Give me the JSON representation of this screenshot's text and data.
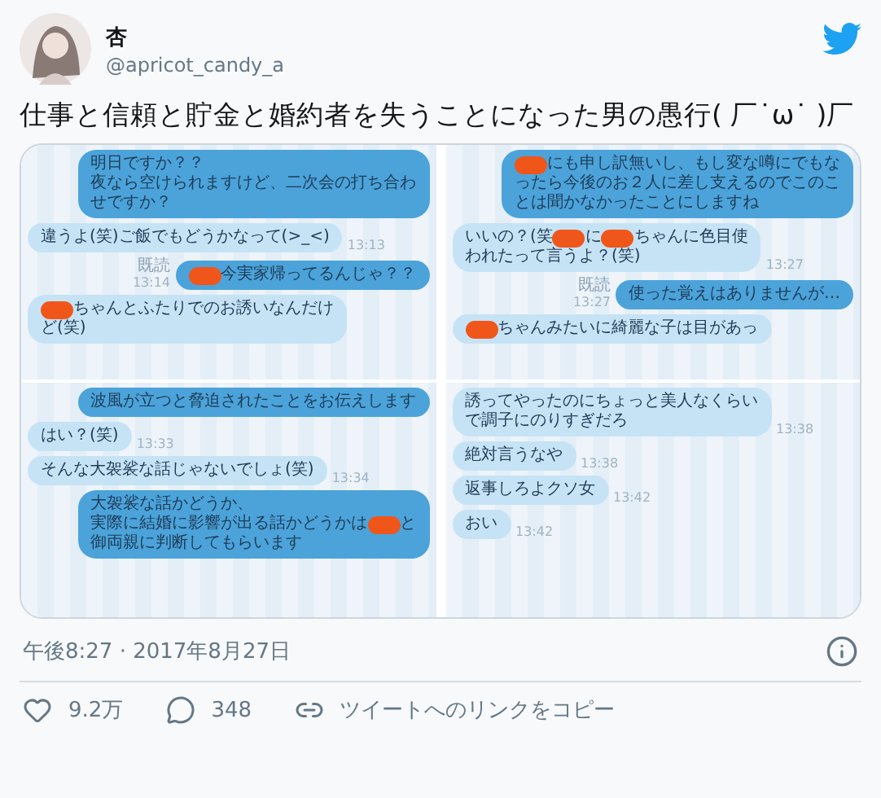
{
  "author": {
    "name": "杏",
    "handle": "@apricot_candy_a"
  },
  "text": "仕事と信頼と貯金と婚約者を失うことになった男の愚行( 厂˙ω˙ )厂",
  "chat_image": {
    "columns": [
      {
        "screens": [
          {
            "messages": [
              {
                "kind": "sent",
                "lines": [
                  [
                    {
                      "kind": "text",
                      "text": "明日ですか？？"
                    }
                  ],
                  [
                    {
                      "kind": "text",
                      "text": "夜なら空けられますけど、二次会の打ち合わ"
                    }
                  ],
                  [
                    {
                      "kind": "text",
                      "text": "せですか？"
                    }
                  ]
                ]
              },
              {
                "kind": "received",
                "lines": [
                  [
                    {
                      "kind": "text",
                      "text": "違うよ(笑)ご飯でもどうかなって(>_<)"
                    }
                  ]
                ],
                "time": "13:13"
              },
              {
                "kind": "sent",
                "lines": [
                  [
                    {
                      "kind": "redaction"
                    },
                    {
                      "kind": "text",
                      "text": "今実家帰ってるんじゃ？？"
                    }
                  ]
                ],
                "read": "既読",
                "time": "13:14"
              },
              {
                "kind": "received",
                "lines": [
                  [
                    {
                      "kind": "redaction"
                    },
                    {
                      "kind": "text",
                      "text": "ちゃんとふたりでのお誘いなんだけ"
                    }
                  ],
                  [
                    {
                      "kind": "text",
                      "text": "ど(笑)"
                    }
                  ]
                ]
              }
            ]
          },
          {
            "messages": [
              {
                "kind": "sent",
                "lines": [
                  [
                    {
                      "kind": "text",
                      "text": "波風が立つと脅迫されたことをお伝えします"
                    }
                  ]
                ]
              },
              {
                "kind": "received",
                "lines": [
                  [
                    {
                      "kind": "text",
                      "text": "はい？(笑)"
                    }
                  ]
                ],
                "time": "13:33"
              },
              {
                "kind": "received",
                "lines": [
                  [
                    {
                      "kind": "text",
                      "text": "そんな大袈裟な話じゃないでしょ(笑)"
                    }
                  ]
                ],
                "time": "13:34"
              },
              {
                "kind": "sent",
                "lines": [
                  [
                    {
                      "kind": "text",
                      "text": "大袈裟な話かどうか、"
                    }
                  ],
                  [
                    {
                      "kind": "text",
                      "text": "実際に結婚に影響が出る話かどうかは"
                    },
                    {
                      "kind": "redaction"
                    },
                    {
                      "kind": "text",
                      "text": "と"
                    }
                  ],
                  [
                    {
                      "kind": "text",
                      "text": "御両親に判断してもらいます"
                    }
                  ]
                ]
              }
            ]
          }
        ]
      },
      {
        "screens": [
          {
            "messages": [
              {
                "kind": "sent",
                "lines": [
                  [
                    {
                      "kind": "redaction"
                    },
                    {
                      "kind": "text",
                      "text": "にも申し訳無いし、もし変な噂にでもな"
                    }
                  ],
                  [
                    {
                      "kind": "text",
                      "text": "ったら今後のお２人に差し支えるのでこのこ"
                    }
                  ],
                  [
                    {
                      "kind": "text",
                      "text": "とは聞かなかったことにしますね"
                    }
                  ]
                ]
              },
              {
                "kind": "received",
                "lines": [
                  [
                    {
                      "kind": "text",
                      "text": "いいの？(笑"
                    },
                    {
                      "kind": "redaction"
                    },
                    {
                      "kind": "text",
                      "text": "に"
                    },
                    {
                      "kind": "redaction"
                    },
                    {
                      "kind": "text",
                      "text": "ちゃんに色目使"
                    }
                  ],
                  [
                    {
                      "kind": "text",
                      "text": "われたって言うよ？(笑)"
                    }
                  ]
                ],
                "time": "13:27"
              },
              {
                "kind": "sent",
                "lines": [
                  [
                    {
                      "kind": "text",
                      "text": "使った覚えはありませんが…"
                    }
                  ]
                ],
                "read": "既読",
                "time": "13:27"
              },
              {
                "kind": "received",
                "lines": [
                  [
                    {
                      "kind": "redaction"
                    },
                    {
                      "kind": "text",
                      "text": "ちゃんみたいに綺麗な子は目があっ"
                    }
                  ]
                ]
              }
            ]
          },
          {
            "messages": [
              {
                "kind": "received",
                "lines": [
                  [
                    {
                      "kind": "text",
                      "text": "誘ってやったのにちょっと美人なくらい"
                    }
                  ],
                  [
                    {
                      "kind": "text",
                      "text": "で調子にのりすぎだろ"
                    }
                  ]
                ],
                "time": "13:38"
              },
              {
                "kind": "received",
                "lines": [
                  [
                    {
                      "kind": "text",
                      "text": "絶対言うなや"
                    }
                  ]
                ],
                "time": "13:38"
              },
              {
                "kind": "received",
                "lines": [
                  [
                    {
                      "kind": "text",
                      "text": "返事しろよクソ女"
                    }
                  ]
                ],
                "time": "13:42"
              },
              {
                "kind": "received",
                "lines": [
                  [
                    {
                      "kind": "text",
                      "text": "おい"
                    }
                  ]
                ],
                "time": "13:42"
              }
            ]
          }
        ]
      }
    ]
  },
  "timestamp": "午後8:27 · 2017年8月27日",
  "actions": [
    {
      "kind": "like",
      "label": "9.2万"
    },
    {
      "kind": "reply",
      "label": "348"
    },
    {
      "kind": "link",
      "label": "ツイートへのリンクをコピー"
    }
  ]
}
